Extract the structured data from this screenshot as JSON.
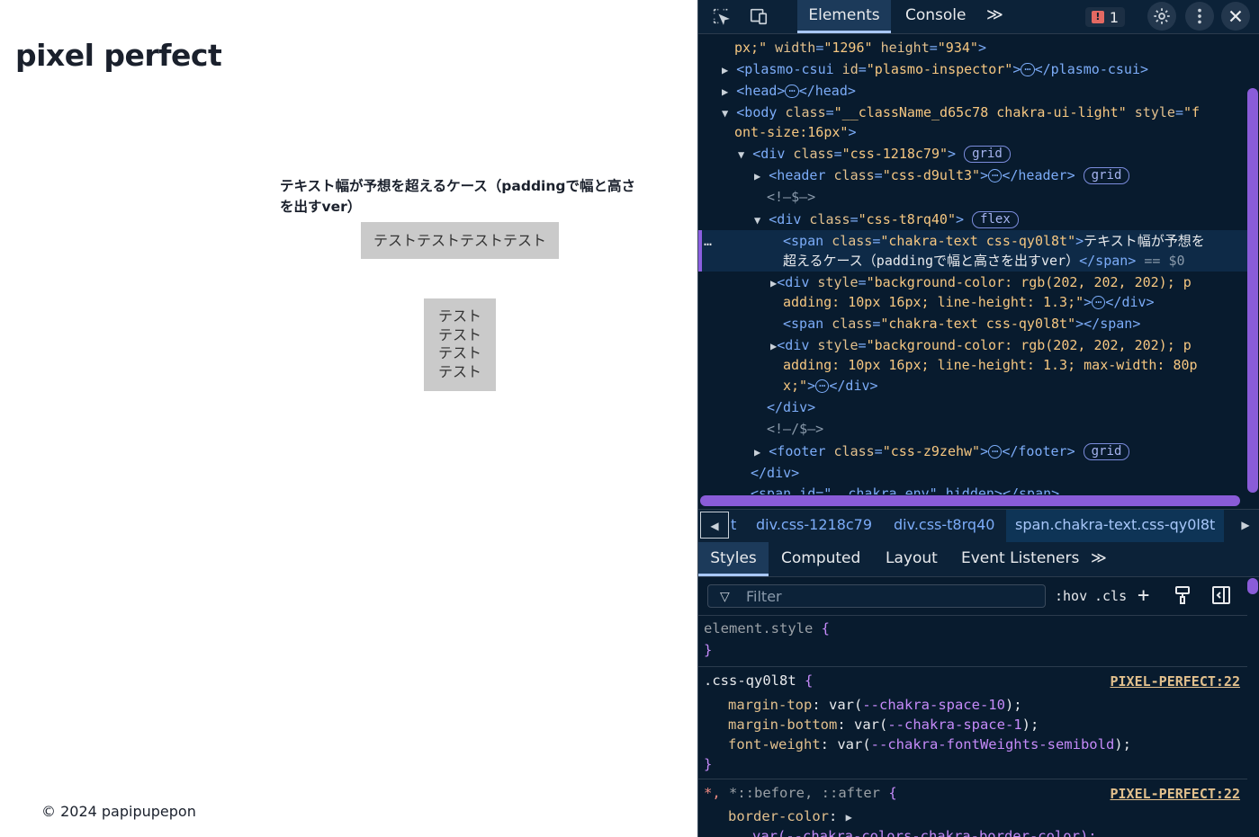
{
  "page": {
    "title": "pixel perfect",
    "heading": "テキスト幅が予想を超えるケース（paddingで幅と高さを出すver）",
    "box1_text": "テストテストテストテスト",
    "box2_text": "テストテストテストテスト",
    "footer": "© 2024 papipupepon"
  },
  "devtools": {
    "tabs": {
      "elements": "Elements",
      "console": "Console",
      "more": "≫"
    },
    "issues_count": "1",
    "dom_lines": {
      "l0_a": "px;\"",
      "l0_attr1": "width",
      "l0_val1": "\"1296\"",
      "l0_attr2": "height",
      "l0_val2": "\"934\"",
      "l1_tag": "plasmo-csui",
      "l1_attr": "id",
      "l1_val": "\"plasmo-inspector\"",
      "l1_close": "</plasmo-csui>",
      "l2_tag": "<head>",
      "l2_close": "</head>",
      "l3_tag": "<body",
      "l3_attr1": "class",
      "l3_val1": "\"__className_d65c78 chakra-ui-light\"",
      "l3_attr2": "style",
      "l3_val2a": "\"f",
      "l3b": "ont-size:16px\"",
      "l4_tag": "<div",
      "l4_attr": "class",
      "l4_val": "\"css-1218c79\"",
      "l4_badge": "grid",
      "l5_tag": "<header",
      "l5_attr": "class",
      "l5_val": "\"css-d9ult3\"",
      "l5_close": "</header>",
      "l5_badge": "grid",
      "l6_comment": "<!—$—>",
      "l7_tag": "<div",
      "l7_attr": "class",
      "l7_val": "\"css-t8rq40\"",
      "l7_badge": "flex",
      "l8_tag": "<span",
      "l8_attr": "class",
      "l8_val": "\"chakra-text css-qy0l8t\"",
      "l8_text": "テキスト幅が予想を",
      "l8b_text": "超えるケース（paddingで幅と高さを出すver）",
      "l8b_close": "</span>",
      "l8b_eq": "== $0",
      "l9_tag": "<div",
      "l9_attr": "style",
      "l9_val": "\"background-color: rgb(202, 202, 202); p",
      "l9b_val": "adding: 10px 16px; line-height: 1.3;\"",
      "l9b_close": "</div>",
      "l10_tag": "<span",
      "l10_attr": "class",
      "l10_val": "\"chakra-text css-qy0l8t\"",
      "l10_close": "></span>",
      "l11_tag": "<div",
      "l11_attr": "style",
      "l11_val": "\"background-color: rgb(202, 202, 202); p",
      "l11b_val": "adding: 10px 16px; line-height: 1.3; max-width: 80p",
      "l11c_val": "x;\"",
      "l11c_close": "</div>",
      "l12_close": "</div>",
      "l13_comment": "<!—/$—>",
      "l14_tag": "<footer",
      "l14_attr": "class",
      "l14_val": "\"css-z9zehw\"",
      "l14_close": "</footer>",
      "l14_badge": "grid",
      "l15_close": "</div>",
      "l16_partial": "<span id=\"__chakra_env\" hidden></span>"
    },
    "breadcrumbs": [
      "t",
      "div.css-1218c79",
      "div.css-t8rq40",
      "span.chakra-text.css-qy0l8t"
    ],
    "style_tabs": {
      "styles": "Styles",
      "computed": "Computed",
      "layout": "Layout",
      "listeners": "Event Listeners",
      "more": "≫"
    },
    "filter_placeholder": "Filter",
    "filter_tools": {
      "hov": ":hov",
      "cls": ".cls"
    },
    "rules": {
      "element_style": "element.style",
      "rule2_selector": ".css-qy0l8t",
      "rule2_source": "PIXEL-PERFECT:22",
      "rule2_props": [
        {
          "name": "margin-top",
          "var": "--chakra-space-10",
          "post": ");"
        },
        {
          "name": "margin-bottom",
          "var": "--chakra-space-1",
          "post": ");"
        },
        {
          "name": "font-weight",
          "var": "--chakra-fontWeights-semibold",
          "post": ");"
        }
      ],
      "rule3_selector_a": "*,",
      "rule3_selector_b": "*::before, ::after",
      "rule3_source": "PIXEL-PERFECT:22",
      "rule3_prop": "border-color",
      "rule3_partial": "var(--chakra-colors-chakra-border-color);"
    },
    "colors": {
      "bg": "#081b2e",
      "accent": "#a8c7fa",
      "selection": "#8b5fe0"
    }
  }
}
